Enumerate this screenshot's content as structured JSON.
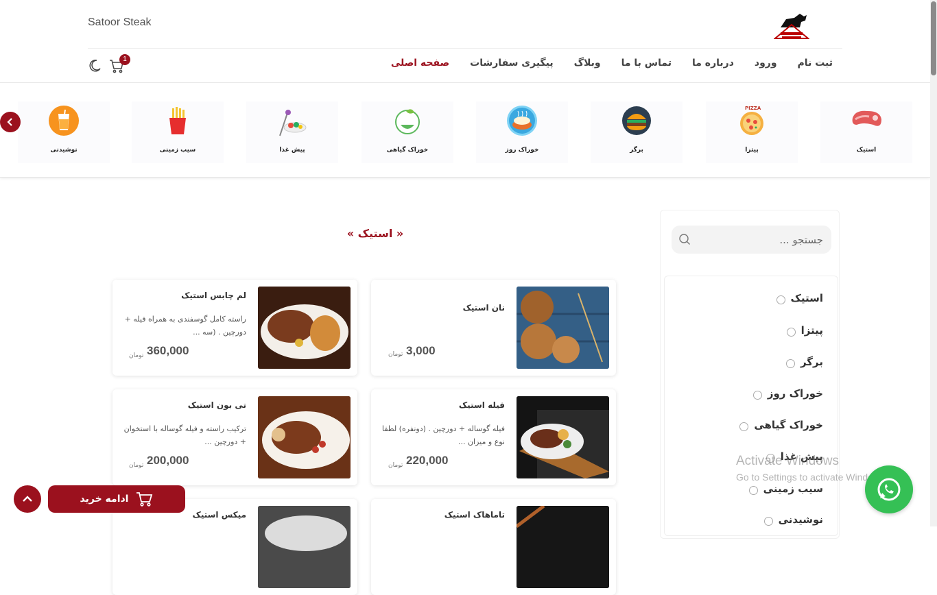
{
  "header": {
    "brand": "Satoor Steak",
    "nav": [
      {
        "label": "صفحه اصلی",
        "active": true
      },
      {
        "label": "پیگیری سفارشات",
        "active": false
      },
      {
        "label": "وبلاگ",
        "active": false
      },
      {
        "label": "تماس با ما",
        "active": false
      },
      {
        "label": "درباره ما",
        "active": false
      },
      {
        "label": "ورود",
        "active": false
      },
      {
        "label": "ثبت نام",
        "active": false
      }
    ],
    "cart_count": "1"
  },
  "categories": [
    {
      "label": "استیک",
      "icon": "steak-icon"
    },
    {
      "label": "پیتزا",
      "icon": "pizza-icon"
    },
    {
      "label": "برگر",
      "icon": "burger-icon"
    },
    {
      "label": "خوراک روز",
      "icon": "daily-dish-icon"
    },
    {
      "label": "خوراک گیاهی",
      "icon": "vegetarian-icon"
    },
    {
      "label": "پیش غذا",
      "icon": "appetizer-icon"
    },
    {
      "label": "سیب زمینی",
      "icon": "fries-icon"
    },
    {
      "label": "نوشیدنی",
      "icon": "drink-icon"
    }
  ],
  "sidebar": {
    "search_placeholder": "جستجو ...",
    "filters": [
      "استیک",
      "پیتزا",
      "برگر",
      "خوراک روز",
      "خوراک گیاهی",
      "پیش غذا",
      "سیب زمینی",
      "نوشیدنی"
    ]
  },
  "section_title": "« استیک »",
  "products": [
    {
      "name": "نان استیک",
      "desc": "",
      "price": "3,000",
      "unit": "تومان"
    },
    {
      "name": "لم چابس استیک",
      "desc": "راسته کامل گوسفندی به همراه فیله + دورچین . (سه ...",
      "price": "360,000",
      "unit": "تومان"
    },
    {
      "name": "فیله استیک",
      "desc": "فیله گوساله + دورچین . (دونفره) لطفا نوع و میزان ...",
      "price": "220,000",
      "unit": "تومان"
    },
    {
      "name": "تی بون استیک",
      "desc": "ترکیب راسته و فیله گوساله با استخوان + دورچین ...",
      "price": "200,000",
      "unit": "تومان"
    },
    {
      "name": "تاماهاک استیک",
      "desc": "",
      "price": "",
      "unit": ""
    },
    {
      "name": "میکس استیک",
      "desc": "",
      "price": "",
      "unit": ""
    }
  ],
  "footer": {
    "continue_label": "ادامه خرید"
  },
  "watermark": {
    "line1": "Activate Windows",
    "line2": "Go to Settings to activate Windows."
  },
  "colors": {
    "accent": "#9b111e",
    "whatsapp": "#35c055"
  }
}
